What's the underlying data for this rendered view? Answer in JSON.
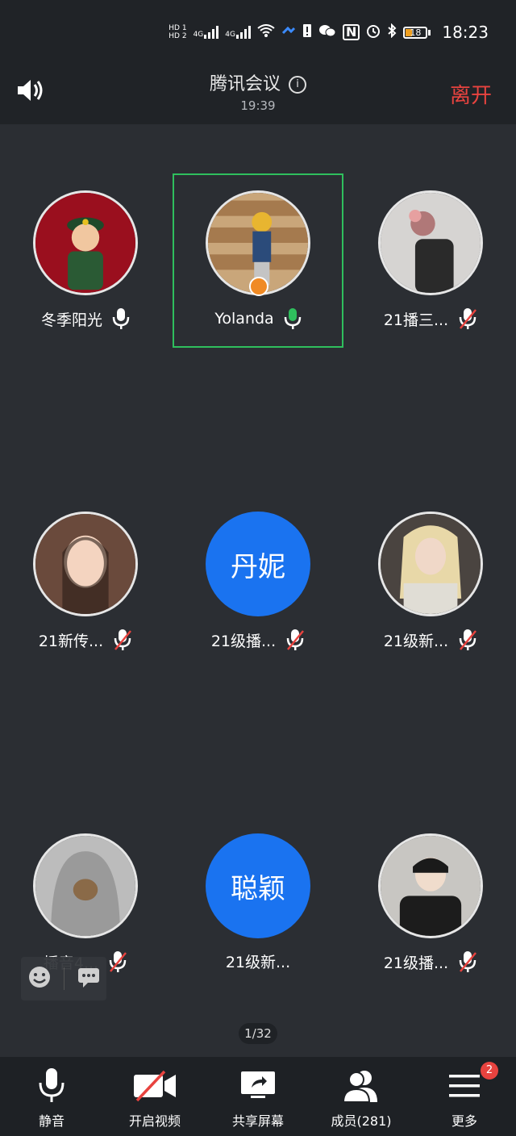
{
  "status_bar": {
    "hd1": "HD 1",
    "hd2": "HD 2",
    "net1": "4G",
    "net2": "4G",
    "nfc": "N",
    "battery": "18",
    "time": "18:23"
  },
  "header": {
    "title": "腾讯会议",
    "duration": "19:39",
    "leave_label": "离开"
  },
  "participants": [
    {
      "name": "冬季阳光",
      "avatar_text": ""
    },
    {
      "name": "Yolanda",
      "avatar_text": ""
    },
    {
      "name": "21播三...",
      "avatar_text": ""
    },
    {
      "name": "21新传...",
      "avatar_text": ""
    },
    {
      "name": "21级播...",
      "avatar_text": "丹妮"
    },
    {
      "name": "21级新...",
      "avatar_text": ""
    },
    {
      "name": "播音4...",
      "avatar_text": ""
    },
    {
      "name": "21级新...",
      "avatar_text": "聪颖"
    },
    {
      "name": "21级播...",
      "avatar_text": ""
    }
  ],
  "pagination": "1/32",
  "toolbar": {
    "mute": "静音",
    "video": "开启视频",
    "share": "共享屏幕",
    "members": "成员(281)",
    "more": "更多",
    "more_badge": "2"
  },
  "colors": {
    "accent_blue": "#1a73f0",
    "leave_red": "#e8433f",
    "speaking_green": "#2fbf5d"
  }
}
